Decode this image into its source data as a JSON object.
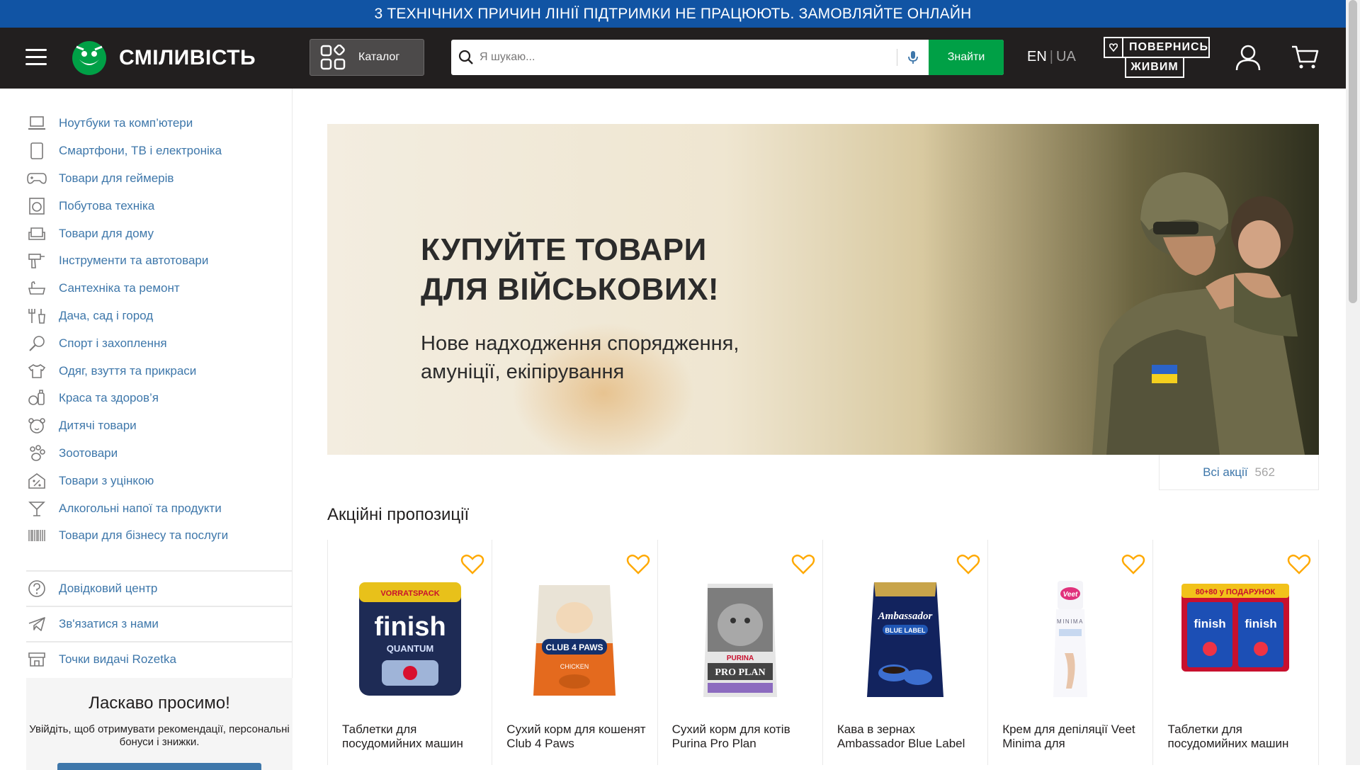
{
  "topbar": {
    "text": "3 ТЕХНІЧНИХ ПРИЧИН ЛІНІЇ ПІДТРИМКИ НЕ ПРАЦЮЮТЬ. ЗАМОВЛЯЙТЕ ОНЛАЙН"
  },
  "header": {
    "logo_text": "СМІЛИВІСТЬ",
    "catalog_label": "Каталог",
    "search_placeholder": "Я шукаю...",
    "search_button": "Знайти",
    "lang_en": "EN",
    "lang_sep": "|",
    "lang_ua": "UA",
    "badge_line1": "ПОВЕРНИСЬ",
    "badge_line2": "ЖИВИМ"
  },
  "sidebar": {
    "categories": [
      {
        "label": "Ноутбуки та комп’ютери",
        "icon": "laptop-icon"
      },
      {
        "label": "Смартфони, ТВ і електроніка",
        "icon": "smartphone-icon"
      },
      {
        "label": "Товари для геймерів",
        "icon": "gamepad-icon"
      },
      {
        "label": "Побутова техніка",
        "icon": "washing-machine-icon"
      },
      {
        "label": "Товари для дому",
        "icon": "armchair-icon"
      },
      {
        "label": "Інструменти та автотовари",
        "icon": "drill-icon"
      },
      {
        "label": "Сантехніка та ремонт",
        "icon": "bathtub-icon"
      },
      {
        "label": "Дача, сад і город",
        "icon": "garden-tools-icon"
      },
      {
        "label": "Спорт і захоплення",
        "icon": "racket-icon"
      },
      {
        "label": "Одяг, взуття та прикраси",
        "icon": "tshirt-icon"
      },
      {
        "label": "Краса та здоров’я",
        "icon": "beauty-icon"
      },
      {
        "label": "Дитячі товари",
        "icon": "teddy-bear-icon"
      },
      {
        "label": "Зоотовари",
        "icon": "paw-icon"
      },
      {
        "label": "Товари з уцінкою",
        "icon": "discount-icon"
      },
      {
        "label": "Алкогольні напої та продукти",
        "icon": "cocktail-icon"
      },
      {
        "label": "Товари для бізнесу та послуги",
        "icon": "barcode-icon"
      }
    ],
    "help": [
      {
        "label": "Довідковий центр",
        "icon": "question-icon"
      },
      {
        "label": "Зв'язатися з нами",
        "icon": "telegram-icon"
      },
      {
        "label": "Точки видачі Rozetka",
        "icon": "store-icon"
      }
    ],
    "welcome_title": "Ласкаво просимо!",
    "welcome_text": "Увійдіть, щоб отримувати рекомендації, персональні бонуси і знижки."
  },
  "banner": {
    "headline_line1": "КУПУЙТЕ ТОВАРИ",
    "headline_line2": "ДЛЯ ВІЙСЬКОВИХ!",
    "sub_line1": "Нове надходження спорядження,",
    "sub_line2": "амуніції, екіпірування"
  },
  "promos": {
    "all_label": "Всі акції",
    "count": "562"
  },
  "section_title": "Акційні пропозиції",
  "products": [
    {
      "title": "Таблетки для посудомийних машин"
    },
    {
      "title": "Сухий корм для кошенят Club 4 Paws"
    },
    {
      "title": "Сухий корм для котів Purina Pro Plan"
    },
    {
      "title": "Кава в зернах Ambassador Blue Label"
    },
    {
      "title": "Крем для депіляції Veet Minima для"
    },
    {
      "title": "Таблетки для посудомийних машин"
    }
  ],
  "product_pack_text": {
    "p1_top": "VORRATSPACK",
    "p1_brand": "finish",
    "p1_line": "QUANTUM",
    "p2_brand": "CLUB 4 PAWS",
    "p2_line": "CHICKEN",
    "p3_brand": "PURINA",
    "p3_line": "PRO PLAN",
    "p4_brand": "Ambassador",
    "p4_line": "BLUE LABEL",
    "p5_brand": "Veet",
    "p5_line": "MINIMA",
    "p6_top": "80+80 у ПОДАРУНОК",
    "p6_brand": "finish"
  },
  "colors": {
    "topbar": "#1154a4",
    "header": "#221f1f",
    "accent_green": "#00a046",
    "link": "#3e77aa",
    "heart": "#ffa900"
  }
}
